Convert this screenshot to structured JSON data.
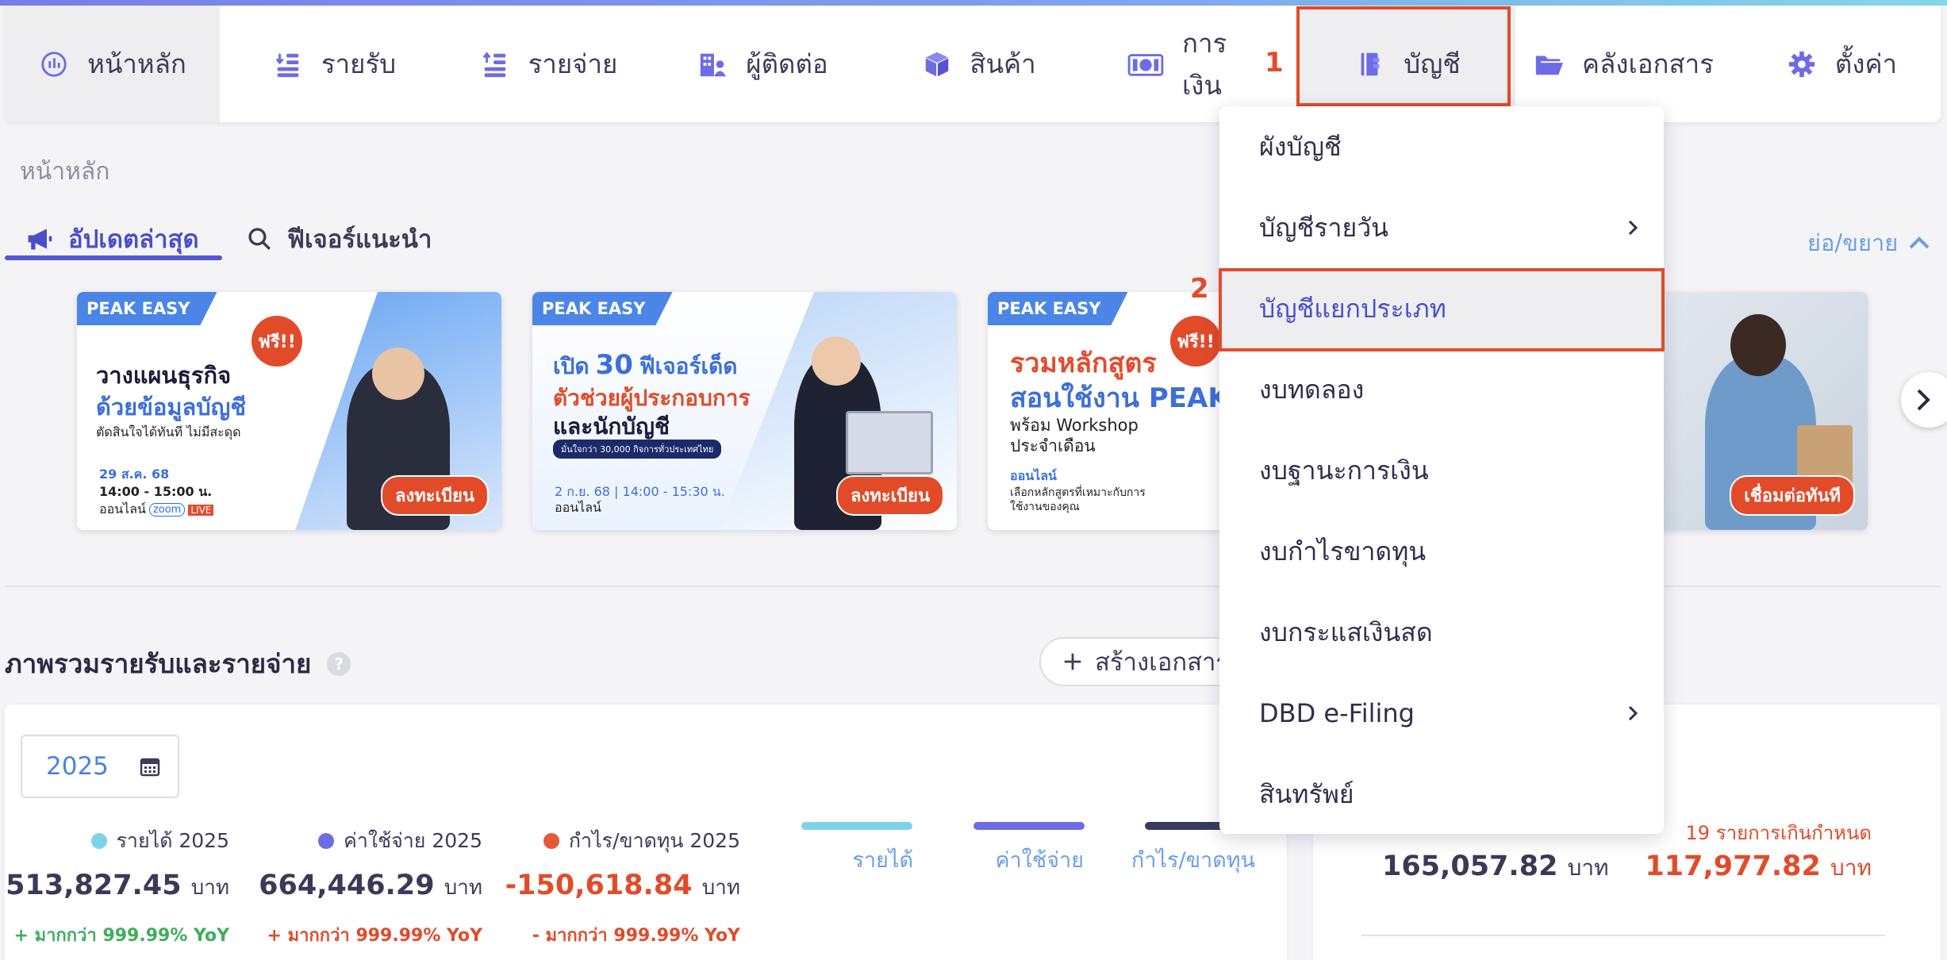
{
  "nav": {
    "items": [
      {
        "label": "หน้าหลัก",
        "icon": "dashboard-icon"
      },
      {
        "label": "รายรับ",
        "icon": "income-icon"
      },
      {
        "label": "รายจ่าย",
        "icon": "expense-icon"
      },
      {
        "label": "ผู้ติดต่อ",
        "icon": "contacts-icon"
      },
      {
        "label": "สินค้า",
        "icon": "product-box-icon"
      },
      {
        "label": "การเงิน",
        "icon": "money-icon"
      },
      {
        "label": "บัญชี",
        "icon": "ledger-book-icon"
      },
      {
        "label": "คลังเอกสาร",
        "icon": "folder-icon"
      },
      {
        "label": "ตั้งค่า",
        "icon": "gear-icon"
      }
    ],
    "step1": "1",
    "step2": "2"
  },
  "breadcrumb": "หน้าหลัก",
  "tabs": {
    "updates": "อัปเดตล่าสุด",
    "features": "ฟีเจอร์แนะนำ"
  },
  "collapse_toggle": "ย่อ/ขยาย",
  "banners": [
    {
      "tag": "PEAK EASY",
      "free": "ฟรี!!",
      "line1": "วางแผนธุรกิจ",
      "line2": "ด้วยข้อมูลบัญชี",
      "sub": "ตัดสินใจได้ทันที ไม่มีสะดุด",
      "date": "29 ส.ค. 68",
      "time": "14:00 - 15:00 น.",
      "channel": "ออนไลน์",
      "zoom": "zoom",
      "live": "LIVE",
      "cta": "ลงทะเบียน"
    },
    {
      "tag": "PEAK EASY",
      "line1_pre": "เปิด",
      "line1_num": "30",
      "line1_post": "ฟีเจอร์เด็ด",
      "line2": "ตัวช่วยผู้ประกอบการ",
      "line3": "และนักบัญชี",
      "pill": "มั่นใจกว่า 30,000 กิจการทั่วประเทศไทย",
      "datetime": "2 ก.ย. 68 | 14:00 - 15:30 น.",
      "channel": "ออนไลน์",
      "cta": "ลงทะเบียน"
    },
    {
      "tag": "PEAK EASY",
      "free": "ฟรี!!",
      "line1": "รวมหลักสูตร",
      "line2": "สอนใช้งาน PEAK",
      "line3": "พร้อม Workshop",
      "line4": "ประจำเดือน",
      "channel": "ออนไลน์",
      "desc1": "เลือกหลักสูตรที่เหมาะกับการ",
      "desc2": "ใช้งานของคุณ"
    },
    {
      "cta": "เชื่อมต่อทันที"
    }
  ],
  "section": {
    "title": "ภาพรวมรายรับและรายจ่าย",
    "help": "?",
    "create_doc": "สร้างเอกสาร"
  },
  "year_select": "2025",
  "metrics": [
    {
      "label": "รายได้ 2025",
      "value": "513,827.45",
      "unit": "บาท",
      "yoy": "+ มากกว่า 999.99% YoY",
      "dot_color": "#7fd3e8",
      "value_color": "#3a3a58",
      "yoy_color": "#3fae5a"
    },
    {
      "label": "ค่าใช้จ่าย 2025",
      "value": "664,446.29",
      "unit": "บาท",
      "yoy": "+ มากกว่า 999.99% YoY",
      "dot_color": "#6d6be6",
      "value_color": "#3a3a58",
      "yoy_color": "#e24b2a"
    },
    {
      "label": "กำไร/ขาดทุน 2025",
      "value": "-150,618.84",
      "unit": "บาท",
      "yoy": "- มากกว่า 999.99% YoY",
      "dot_color": "#e8573a",
      "value_color": "#e24b2a",
      "yoy_color": "#e24b2a"
    }
  ],
  "legend": [
    {
      "label": "รายได้",
      "color": "#7fd3e8"
    },
    {
      "label": "ค่าใช้จ่าย",
      "color": "#6d6be6"
    },
    {
      "label": "กำไร/ขาดทุน",
      "color": "#3a3a5e"
    }
  ],
  "right_card": {
    "overdue_label": "19 รายการเกินกำหนด",
    "amount_left": "165,057.82",
    "amount_right": "117,977.82",
    "unit": "บาท"
  },
  "dropdown": {
    "items": [
      {
        "label": "ผังบัญชี",
        "submenu": false
      },
      {
        "label": "บัญชีรายวัน",
        "submenu": true
      },
      {
        "label": "บัญชีแยกประเภท",
        "submenu": false
      },
      {
        "label": "งบทดลอง",
        "submenu": false
      },
      {
        "label": "งบฐานะการเงิน",
        "submenu": false
      },
      {
        "label": "งบกำไรขาดทุน",
        "submenu": false
      },
      {
        "label": "งบกระแสเงินสด",
        "submenu": false
      },
      {
        "label": "DBD e-Filing",
        "submenu": true
      },
      {
        "label": "สินทรัพย์",
        "submenu": false
      }
    ]
  },
  "colors": {
    "accent": "#5457d1",
    "highlight": "#e24b2a",
    "link_blue": "#6a9fe6",
    "nav_active_bg": "#eeeef1"
  }
}
